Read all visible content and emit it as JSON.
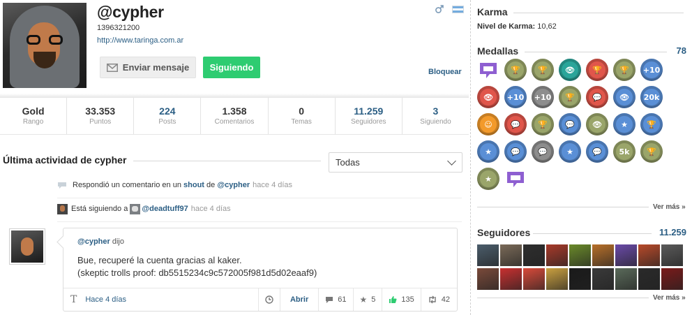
{
  "profile": {
    "username": "@cypher",
    "user_id": "1396321200",
    "url": "http://www.taringa.com.ar",
    "send_message_label": "Enviar mensaje",
    "following_label": "Siguiendo",
    "block_label": "Bloquear",
    "gender_icon": "male-icon",
    "flag_icon": "argentina-flag-icon"
  },
  "stats": [
    {
      "value": "Gold",
      "label": "Rango",
      "is_link": false
    },
    {
      "value": "33.353",
      "label": "Puntos",
      "is_link": false
    },
    {
      "value": "224",
      "label": "Posts",
      "is_link": true
    },
    {
      "value": "1.358",
      "label": "Comentarios",
      "is_link": false
    },
    {
      "value": "0",
      "label": "Temas",
      "is_link": false
    },
    {
      "value": "11.259",
      "label": "Seguidores",
      "is_link": true
    },
    {
      "value": "3",
      "label": "Siguiendo",
      "is_link": true
    }
  ],
  "activity": {
    "title": "Última actividad de cypher",
    "filter_value": "Todas",
    "rows": [
      {
        "icon": "comment-bubble-icon",
        "text": "Respondió un comentario en un",
        "link1": "shout",
        "mid": "de",
        "link2": "@cypher",
        "time": "hace 4 días"
      },
      {
        "icon": "user-avatar",
        "text": "Está siguiendo a",
        "link2": "@deadtuff97",
        "time": "hace 4 días"
      }
    ]
  },
  "shout": {
    "author": "@cypher",
    "said": "dijo",
    "line1": "Bue, recuperé la cuenta gracias al kaker.",
    "line2": "(skeptic trolls proof: db5515234c9c572005f981d5d02eaaf9)",
    "time": "Hace 4 días",
    "open_label": "Abrir",
    "comments": "61",
    "favorites": "5",
    "likes": "135",
    "reshouts": "42"
  },
  "sidebar": {
    "karma_title": "Karma",
    "karma_level_label": "Nivel de Karma:",
    "karma_level_value": "10,62",
    "medals_title": "Medallas",
    "medals_count": "78",
    "medals": [
      {
        "color": "flat-purple",
        "icon": "speech-medal-icon",
        "glyph": ""
      },
      {
        "color": "olive",
        "icon": "trophy-medal-icon",
        "glyph": "🏆"
      },
      {
        "color": "olive",
        "icon": "trophy-medal-icon",
        "glyph": "🏆"
      },
      {
        "color": "teal",
        "icon": "eye-medal-icon",
        "glyph": "👁"
      },
      {
        "color": "red",
        "icon": "trophy-medal-icon",
        "glyph": "🏆"
      },
      {
        "color": "olive",
        "icon": "trophy-medal-icon",
        "glyph": "🏆"
      },
      {
        "color": "blue",
        "icon": "plus10-medal-icon",
        "glyph": "+10"
      },
      {
        "color": "red",
        "icon": "eye-medal-icon",
        "glyph": "👁"
      },
      {
        "color": "blue",
        "icon": "plus10-medal-icon",
        "glyph": "+10"
      },
      {
        "color": "gray",
        "icon": "plus10-medal-icon",
        "glyph": "+10"
      },
      {
        "color": "olive",
        "icon": "trophy-medal-icon",
        "glyph": "🏆"
      },
      {
        "color": "red",
        "icon": "speech-medal-icon",
        "glyph": "💬"
      },
      {
        "color": "blue",
        "icon": "eye-medal-icon",
        "glyph": "👁"
      },
      {
        "color": "blue",
        "icon": "20k-medal-icon",
        "glyph": "20k"
      },
      {
        "color": "orange",
        "icon": "face-medal-icon",
        "glyph": "☺"
      },
      {
        "color": "red",
        "icon": "speech-medal-icon",
        "glyph": "💬"
      },
      {
        "color": "olive",
        "icon": "trophy-medal-icon",
        "glyph": "🏆"
      },
      {
        "color": "blue",
        "icon": "speech-medal-icon",
        "glyph": "💬"
      },
      {
        "color": "olive",
        "icon": "eye-medal-icon",
        "glyph": "👁"
      },
      {
        "color": "blue",
        "icon": "star-medal-icon",
        "glyph": "★"
      },
      {
        "color": "blue",
        "icon": "trophy-medal-icon",
        "glyph": "🏆"
      },
      {
        "color": "blue",
        "icon": "star-medal-icon",
        "glyph": "★"
      },
      {
        "color": "blue",
        "icon": "speech-medal-icon",
        "glyph": "💬"
      },
      {
        "color": "gray",
        "icon": "speech-medal-icon",
        "glyph": "💬"
      },
      {
        "color": "blue",
        "icon": "star-medal-icon",
        "glyph": "★"
      },
      {
        "color": "blue",
        "icon": "speech-medal-icon",
        "glyph": "💬"
      },
      {
        "color": "olive",
        "icon": "5k-medal-icon",
        "glyph": "5k"
      },
      {
        "color": "olive",
        "icon": "trophy-medal-icon",
        "glyph": "🏆"
      },
      {
        "color": "olive",
        "icon": "star-medal-icon",
        "glyph": "★"
      },
      {
        "color": "flat-purple",
        "icon": "trophy-medal-icon",
        "glyph": ""
      }
    ],
    "see_more_label": "Ver más »",
    "followers_title": "Seguidores",
    "followers_count": "11.259",
    "followers": [
      "#4b5d6b",
      "#7a6a58",
      "#2e2e2e",
      "#a83a2a",
      "#6a8a2a",
      "#b8702a",
      "#6a4aa8",
      "#b84a2a",
      "#5a5a5a",
      "#7a4a3a",
      "#c83030",
      "#d84a3a",
      "#caa040",
      "#1a1a1a",
      "#3a3a3a",
      "#5a6a5a",
      "#2a2a2a",
      "#7a1a1a"
    ]
  }
}
